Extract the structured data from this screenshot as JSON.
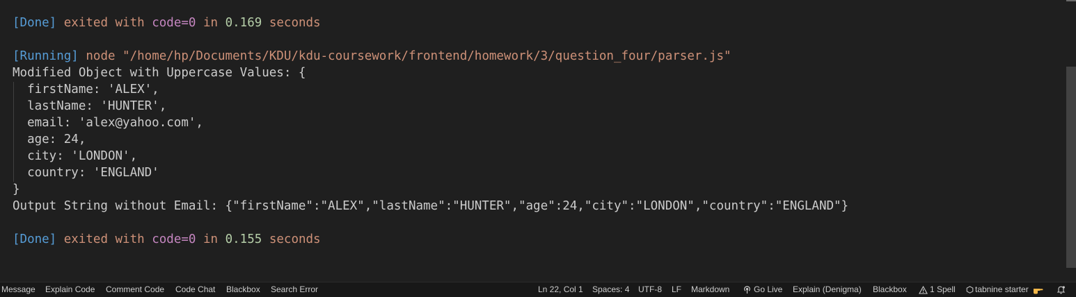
{
  "output": {
    "line1": {
      "tag": "[Done]",
      "exited": "exited with",
      "code": "code=0",
      "in": "in",
      "time": "0.169",
      "seconds": "seconds"
    },
    "line2": {
      "tag": "[Running]",
      "cmd": "node \"/home/hp/Documents/KDU/kdu-coursework/frontend/homework/3/question_four/parser.js\""
    },
    "line3": "Modified Object with Uppercase Values: {",
    "object_lines": [
      "  firstName: 'ALEX',",
      "  lastName: 'HUNTER',",
      "  email: 'alex@yahoo.com',",
      "  age: 24,",
      "  city: 'LONDON',",
      "  country: 'ENGLAND'"
    ],
    "closing": "}",
    "output_string": "Output String without Email: {\"firstName\":\"ALEX\",\"lastName\":\"HUNTER\",\"age\":24,\"city\":\"LONDON\",\"country\":\"ENGLAND\"}",
    "line_last": {
      "tag": "[Done]",
      "exited": "exited with",
      "code": "code=0",
      "in": "in",
      "time": "0.155",
      "seconds": "seconds"
    }
  },
  "status_bar": {
    "left": [
      "Message",
      "Explain Code",
      "Comment Code",
      "Code Chat",
      "Blackbox",
      "Search Error"
    ],
    "position": "Ln 22, Col 1",
    "spaces": "Spaces: 4",
    "encoding": "UTF-8",
    "eol": "LF",
    "language": "Markdown",
    "golive": "Go Live",
    "explain": "Explain (Denigma)",
    "blackbox": "Blackbox",
    "spell": "1 Spell",
    "tabnine": "tabnine starter",
    "icons": {
      "golive": "broadcast-icon",
      "spell": "warning-icon",
      "tabnine": "tabnine-icon",
      "hand": "pointing-hand-icon",
      "bell": "bell-icon"
    }
  },
  "colors": {
    "background": "#1f1f1f",
    "tag": "#569cd6",
    "orange": "#ce9178",
    "purple": "#c586c0",
    "number": "#b5cea8",
    "text": "#cccccc"
  }
}
